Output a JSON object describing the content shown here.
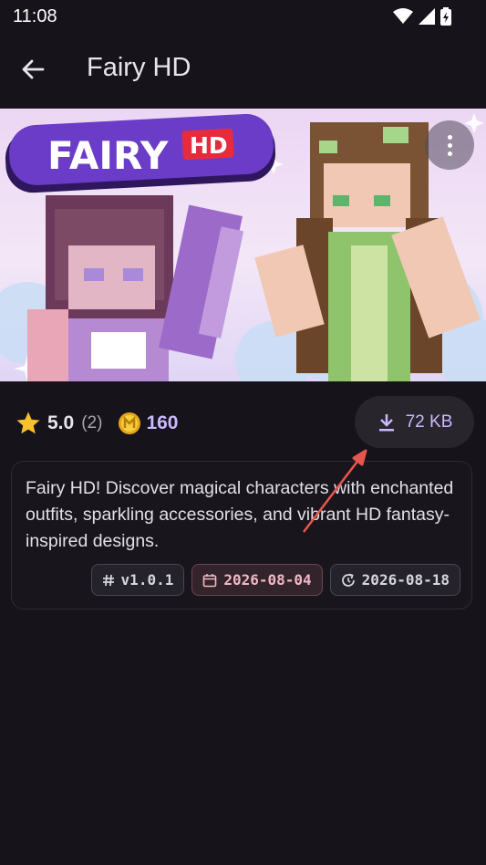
{
  "status": {
    "time": "11:08",
    "icons": [
      "wifi-icon",
      "signal-icon",
      "battery-charging-icon"
    ]
  },
  "appbar": {
    "title": "Fairy HD",
    "back_icon": "arrow-left-icon"
  },
  "banner": {
    "logo_word": "FAIRY",
    "logo_badge": "HD",
    "more_icon": "more-vert-icon"
  },
  "meta": {
    "rating": "5.0",
    "rating_count": "(2)",
    "price": "160",
    "download_size": "72 KB"
  },
  "description": {
    "text": "Fairy HD! Discover magical characters with enchanted outfits, sparkling accessories, and vibrant HD fantasy-inspired designs."
  },
  "chips": {
    "version": "v1.0.1",
    "created": "2026-08-04",
    "updated": "2026-08-18"
  },
  "colors": {
    "background": "#16141a",
    "accent": "#c9b8ff",
    "annotation": "#e8554e"
  }
}
